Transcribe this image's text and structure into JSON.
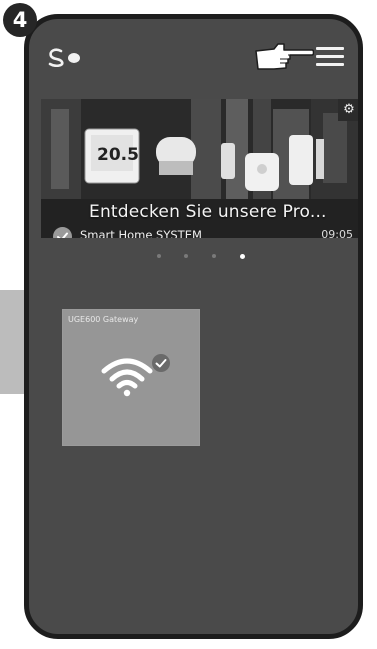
{
  "step": {
    "number": "4"
  },
  "header": {
    "logo_icon": "salus-logo-icon",
    "menu_icon": "hamburger-menu-icon",
    "pointer_icon": "pointing-hand-icon"
  },
  "banner": {
    "headline": "Entdecken Sie unsere Pro...",
    "subtitle": "Smart Home SYSTEM",
    "time": "09:05",
    "settings_icon": "gear-icon",
    "check_icon": "check-circle-icon",
    "display_reading": "20.5"
  },
  "pager": {
    "count": 4,
    "active_index": 3
  },
  "devices": [
    {
      "name": "UGE600 Gateway",
      "icon": "wifi-icon",
      "status_icon": "check-circle-icon"
    }
  ],
  "colors": {
    "screen_background": "#4a4a4a",
    "tile_background": "#969696",
    "frame": "#1d1d1d"
  }
}
